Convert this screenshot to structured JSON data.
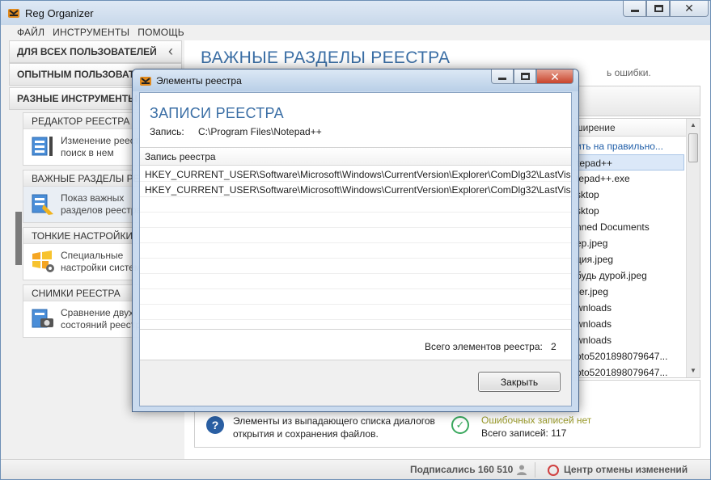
{
  "app": {
    "title": "Reg Organizer",
    "icon": "reg-organizer-logo-icon"
  },
  "menu": [
    "ФАЙЛ",
    "ИНСТРУМЕНТЫ",
    "ПОМОЩЬ"
  ],
  "sidebar": {
    "categories": [
      {
        "label": "ДЛЯ ВСЕХ ПОЛЬЗОВАТЕЛЕЙ"
      },
      {
        "label": "ОПЫТНЫМ ПОЛЬЗОВАТЕЛЯМ"
      },
      {
        "label": "РАЗНЫЕ ИНСТРУМЕНТЫ"
      }
    ],
    "tools": [
      {
        "title": "РЕДАКТОР РЕЕСТРА",
        "desc1": "Изменение реестра,",
        "desc2": "поиск в нем",
        "icon": "registry-editor-icon"
      },
      {
        "title": "ВАЖНЫЕ РАЗДЕЛЫ РЕЕСТРА",
        "desc1": "Показ важных",
        "desc2": "разделов реестра",
        "icon": "registry-cleanup-icon"
      },
      {
        "title": "ТОНКИЕ НАСТРОЙКИ",
        "desc1": "Специальные",
        "desc2": "настройки системы",
        "icon": "windows-tweaks-icon"
      },
      {
        "title": "СНИМКИ РЕЕСТРА",
        "desc1": "Сравнение двух",
        "desc2": "состояний реестра",
        "icon": "registry-snapshot-icon"
      }
    ]
  },
  "content": {
    "title": "ВАЖНЫЕ РАЗДЕЛЫ РЕЕСТРА",
    "subtitle_tail": "ь ошибки.",
    "column_header": "ширение",
    "rows": [
      {
        "text": "ить на правильно...",
        "style": "link"
      },
      {
        "text": "tepad++",
        "style": "selected"
      },
      {
        "text": "tepad++.exe",
        "style": ""
      },
      {
        "text": "sktop",
        "style": ""
      },
      {
        "text": "sktop",
        "style": ""
      },
      {
        "text": "nned Documents",
        "style": ""
      },
      {
        "text": "ep.jpeg",
        "style": ""
      },
      {
        "text": "ция.jpeg",
        "style": ""
      },
      {
        "text": "будь дурой.jpeg",
        "style": ""
      },
      {
        "text": "rer.jpeg",
        "style": ""
      },
      {
        "text": "wnloads",
        "style": ""
      },
      {
        "text": "wnloads",
        "style": ""
      },
      {
        "text": "wnloads",
        "style": ""
      },
      {
        "text": "oto5201898079647...",
        "style": ""
      },
      {
        "text": "oto5201898079647...",
        "style": ""
      }
    ],
    "info": {
      "text": "Элементы из выпадающего списка диалогов открытия и сохранения файлов.",
      "error_status": "Ошибочных записей нет",
      "total": "Всего записей: 117"
    }
  },
  "statusbar": {
    "subscribers": "Подписались 160 510",
    "undo_center": "Центр отмены изменений"
  },
  "dialog": {
    "title": "Элементы реестра",
    "heading": "ЗАПИСИ РЕЕСТРА",
    "entry_label": "Запись:",
    "entry_value": "C:\\Program Files\\Notepad++",
    "table_header": "Запись реестра",
    "rows": [
      "HKEY_CURRENT_USER\\Software\\Microsoft\\Windows\\CurrentVersion\\Explorer\\ComDlg32\\LastVis...",
      "HKEY_CURRENT_USER\\Software\\Microsoft\\Windows\\CurrentVersion\\Explorer\\ComDlg32\\LastVis..."
    ],
    "total_label": "Всего элементов реестра:",
    "total_value": "2",
    "close_label": "Закрыть"
  },
  "colors": {
    "accent_blue": "#3a6ea5",
    "link_blue": "#1f5ea8",
    "ok_green": "#3aa85e",
    "warning_olive": "#9a9a2a",
    "close_red": "#c8432b"
  }
}
